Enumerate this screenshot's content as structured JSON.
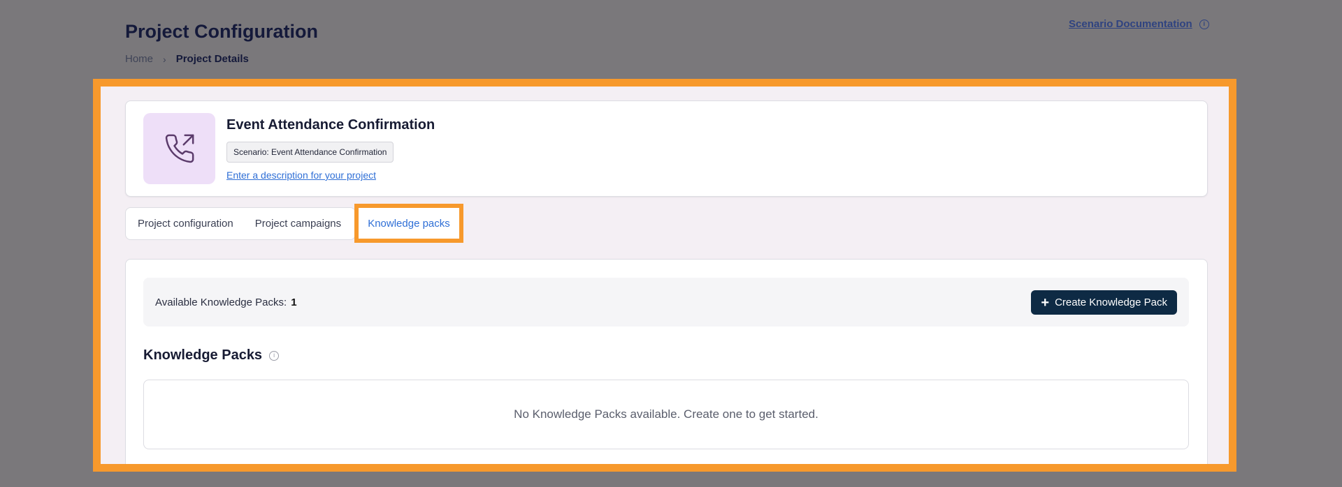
{
  "header": {
    "title": "Project Configuration",
    "breadcrumb": {
      "home": "Home",
      "separator": "›",
      "current": "Project Details"
    },
    "doc_link": "Scenario Documentation",
    "info_glyph": "i"
  },
  "project": {
    "icon": "phone-outgoing-icon",
    "name": "Event Attendance Confirmation",
    "scenario_chip": "Scenario: Event Attendance Confirmation",
    "description_link": "Enter a description for your project"
  },
  "tabs": [
    {
      "label": "Project configuration",
      "active": false
    },
    {
      "label": "Project campaigns",
      "active": false
    },
    {
      "label": "Knowledge packs",
      "active": true
    }
  ],
  "knowledge": {
    "available_label": "Available Knowledge Packs:",
    "available_count": "1",
    "create_plus": "+",
    "create_button": "Create Knowledge Pack",
    "section_title": "Knowledge Packs",
    "info_glyph": "i",
    "empty_message": "No Knowledge Packs available. Create one to get started."
  },
  "colors": {
    "highlight": "#f7992c",
    "primary_button": "#0e2a44",
    "link": "#2f6fd6",
    "icon_bg": "#eedff8"
  }
}
